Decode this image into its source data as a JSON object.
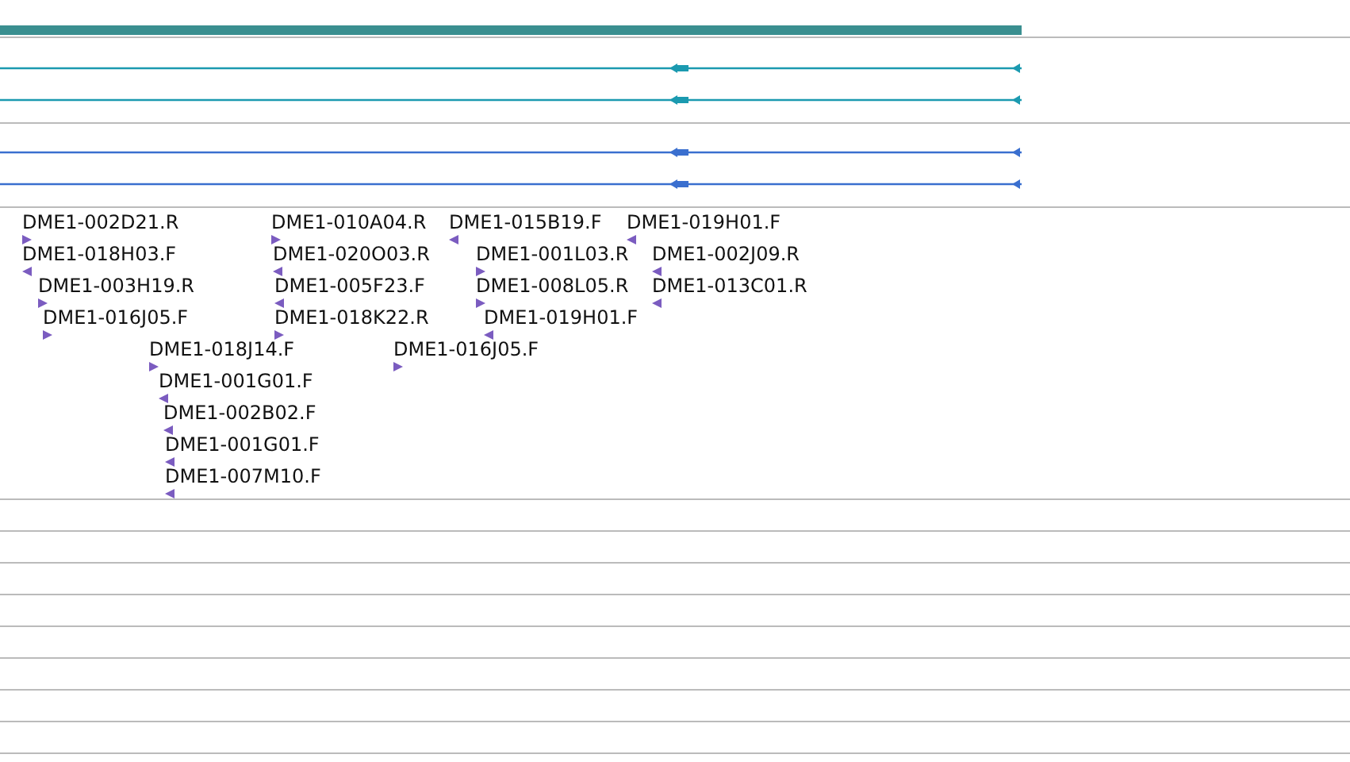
{
  "gene": {
    "color": "#3a8f90"
  },
  "transcripts": [
    {
      "color": "#1b9ab0"
    },
    {
      "color": "#1b9ab0"
    },
    {
      "color": "#3a6fcf"
    },
    {
      "color": "#3a6fcf"
    }
  ],
  "features": [
    {
      "label": "DME1-002D21.R",
      "reverse": false
    },
    {
      "label": "DME1-018H03.F",
      "reverse": true
    },
    {
      "label": "DME1-003H19.R",
      "reverse": false
    },
    {
      "label": "DME1-016J05.F",
      "reverse": false
    },
    {
      "label": "DME1-018J14.F",
      "reverse": false
    },
    {
      "label": "DME1-001G01.F",
      "reverse": true
    },
    {
      "label": "DME1-002B02.F",
      "reverse": true
    },
    {
      "label": "DME1-001G01.F",
      "reverse": true
    },
    {
      "label": "DME1-007M10.F",
      "reverse": true
    },
    {
      "label": "DME1-010A04.R",
      "reverse": false
    },
    {
      "label": "DME1-020O03.R",
      "reverse": true
    },
    {
      "label": "DME1-005F23.F",
      "reverse": true
    },
    {
      "label": "DME1-018K22.R",
      "reverse": false
    },
    {
      "label": "DME1-016J05.F",
      "reverse": false
    },
    {
      "label": "DME1-015B19.F",
      "reverse": true
    },
    {
      "label": "DME1-001L03.R",
      "reverse": false
    },
    {
      "label": "DME1-008L05.R",
      "reverse": false
    },
    {
      "label": "DME1-019H01.F",
      "reverse": true
    },
    {
      "label": "DME1-019H01.F",
      "reverse": true
    },
    {
      "label": "DME1-002J09.R",
      "reverse": true
    },
    {
      "label": "DME1-013C01.R",
      "reverse": true
    }
  ]
}
